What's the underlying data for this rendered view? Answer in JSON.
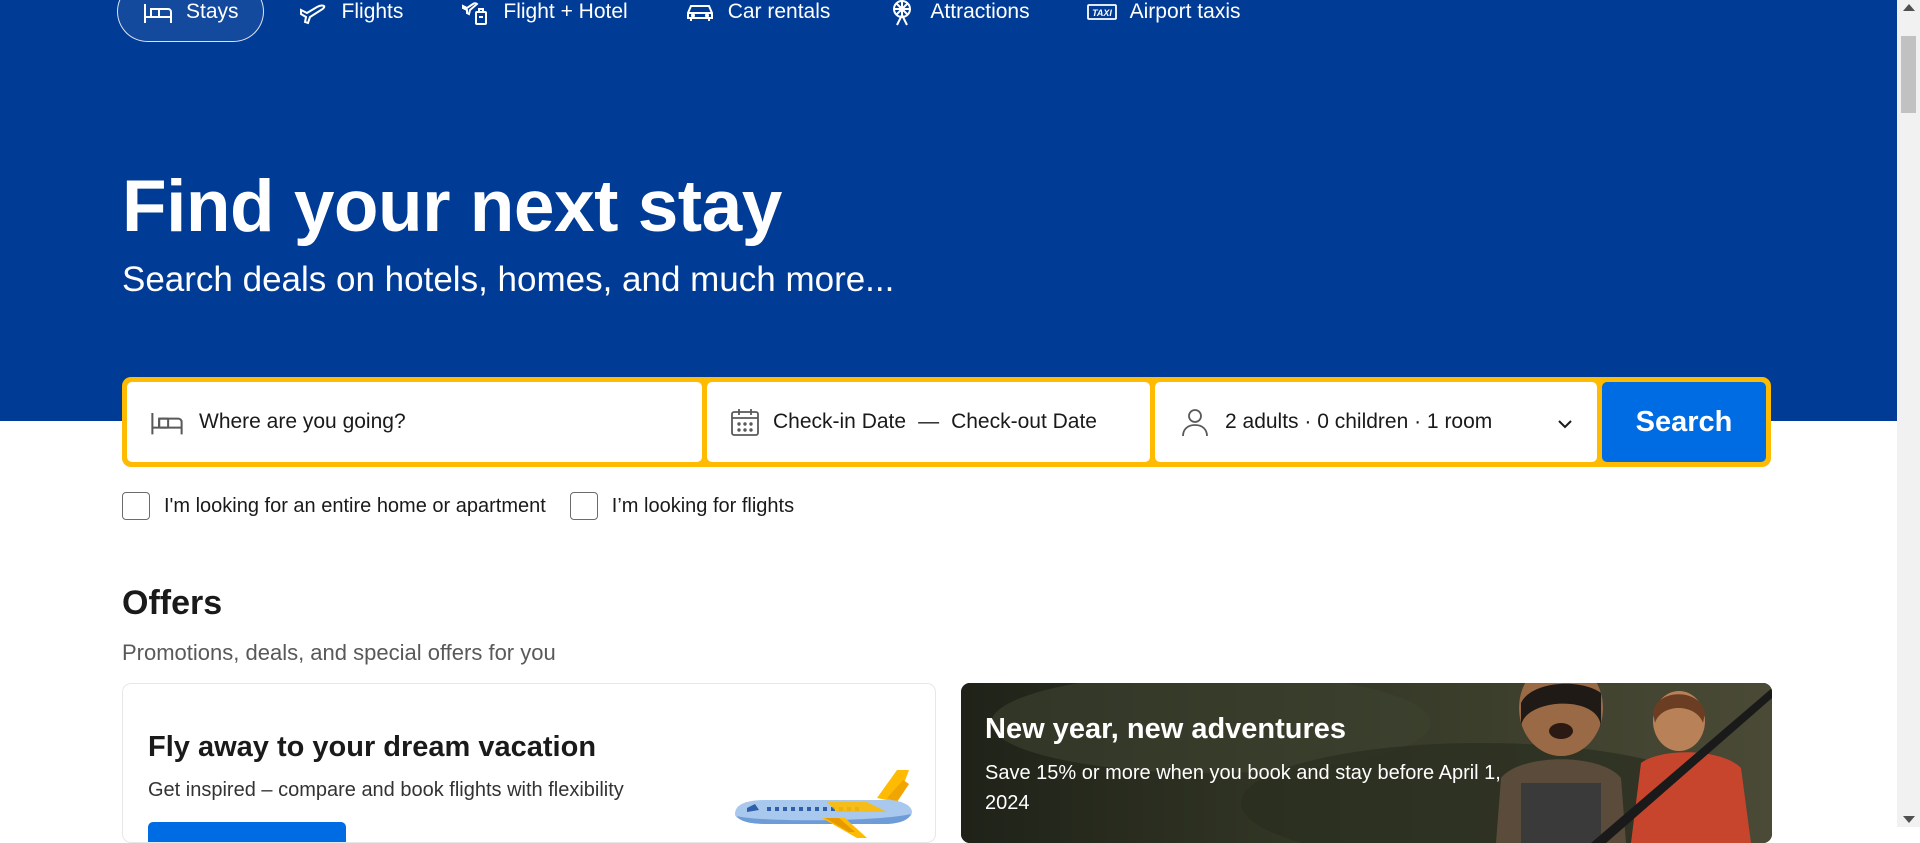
{
  "nav": {
    "items": [
      {
        "label": "Stays",
        "icon": "bed-icon",
        "active": true
      },
      {
        "label": "Flights",
        "icon": "plane-icon"
      },
      {
        "label": "Flight + Hotel",
        "icon": "flight-hotel-icon"
      },
      {
        "label": "Car rentals",
        "icon": "car-icon"
      },
      {
        "label": "Attractions",
        "icon": "ferris-wheel-icon"
      },
      {
        "label": "Airport taxis",
        "icon": "taxi-icon"
      }
    ]
  },
  "hero": {
    "title": "Find your next stay",
    "subtitle": "Search deals on hotels, homes, and much more..."
  },
  "search": {
    "destination_placeholder": "Where are you going?",
    "checkin_placeholder": "Check-in Date",
    "date_separator": "—",
    "checkout_placeholder": "Check-out Date",
    "guests": "2 adults · 0 children · 1 room",
    "button": "Search"
  },
  "options": {
    "entire_home": "I'm looking for an entire home or apartment",
    "flights": "I’m looking for flights"
  },
  "offers": {
    "title": "Offers",
    "subtitle": "Promotions, deals, and special offers for you",
    "cards": [
      {
        "title": "Fly away to your dream vacation",
        "text": "Get inspired – compare and book flights with flexibility"
      },
      {
        "title": "New year, new adventures",
        "text": "Save 15% or more when you book and stay before April 1, 2024"
      }
    ]
  },
  "colors": {
    "brand_blue": "#003b95",
    "accent_yellow": "#febb02",
    "button_blue": "#006ce4"
  }
}
